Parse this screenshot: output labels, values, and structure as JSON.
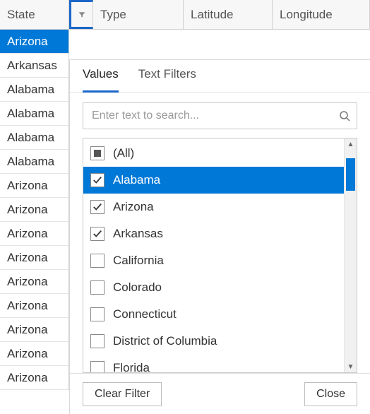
{
  "columns": {
    "state": "State",
    "type": "Type",
    "latitude": "Latitude",
    "longitude": "Longitude"
  },
  "state_rows": [
    {
      "label": "Arizona",
      "selected": true
    },
    {
      "label": "Arkansas"
    },
    {
      "label": "Alabama"
    },
    {
      "label": "Alabama"
    },
    {
      "label": "Alabama"
    },
    {
      "label": "Alabama"
    },
    {
      "label": "Arizona"
    },
    {
      "label": "Arizona"
    },
    {
      "label": "Arizona"
    },
    {
      "label": "Arizona"
    },
    {
      "label": "Arizona"
    },
    {
      "label": "Arizona"
    },
    {
      "label": "Arizona"
    },
    {
      "label": "Arizona"
    },
    {
      "label": "Arizona"
    }
  ],
  "filter": {
    "tabs": {
      "values": "Values",
      "text_filters": "Text Filters"
    },
    "search_placeholder": "Enter text to search...",
    "all_label": "(All)",
    "options": [
      {
        "label": "Alabama",
        "checked": true,
        "selected": true
      },
      {
        "label": "Arizona",
        "checked": true
      },
      {
        "label": "Arkansas",
        "checked": true
      },
      {
        "label": "California",
        "checked": false
      },
      {
        "label": "Colorado",
        "checked": false
      },
      {
        "label": "Connecticut",
        "checked": false
      },
      {
        "label": "District of Columbia",
        "checked": false
      },
      {
        "label": "Florida",
        "checked": false
      }
    ],
    "buttons": {
      "clear": "Clear Filter",
      "close": "Close"
    }
  }
}
